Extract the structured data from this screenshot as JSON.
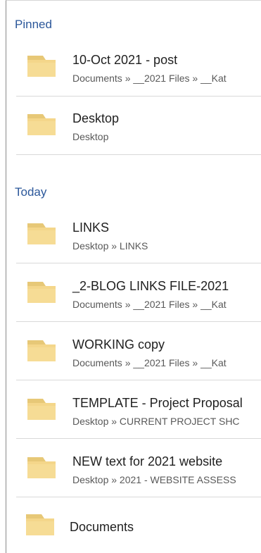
{
  "pinned": {
    "title": "Pinned",
    "items": [
      {
        "name": "10-Oct 2021 - post",
        "path": "Documents » __2021 Files » __Kat",
        "icon": "folder-icon"
      },
      {
        "name": "Desktop",
        "path": "Desktop",
        "icon": "folder-icon"
      }
    ]
  },
  "today": {
    "title": "Today",
    "items": [
      {
        "name": "LINKS",
        "path": "Desktop » LINKS",
        "icon": "folder-icon"
      },
      {
        "name": "_2-BLOG LINKS FILE-2021",
        "path": "Documents » __2021 Files » __Kat",
        "icon": "folder-icon"
      },
      {
        "name": "WORKING copy",
        "path": "Documents » __2021 Files » __Kat",
        "icon": "folder-icon"
      },
      {
        "name": "TEMPLATE - Project Proposal",
        "path": "Desktop » CURRENT PROJECT SHC",
        "icon": "folder-icon"
      },
      {
        "name": "NEW text for 2021 website",
        "path": "Desktop » 2021 - WEBSITE ASSESS",
        "icon": "folder-icon"
      },
      {
        "name": "Documents",
        "icon": "folder-icon"
      }
    ]
  },
  "colors": {
    "section_title": "#2b579a",
    "folder": "#f4d68a",
    "divider": "#d9d9d9"
  }
}
